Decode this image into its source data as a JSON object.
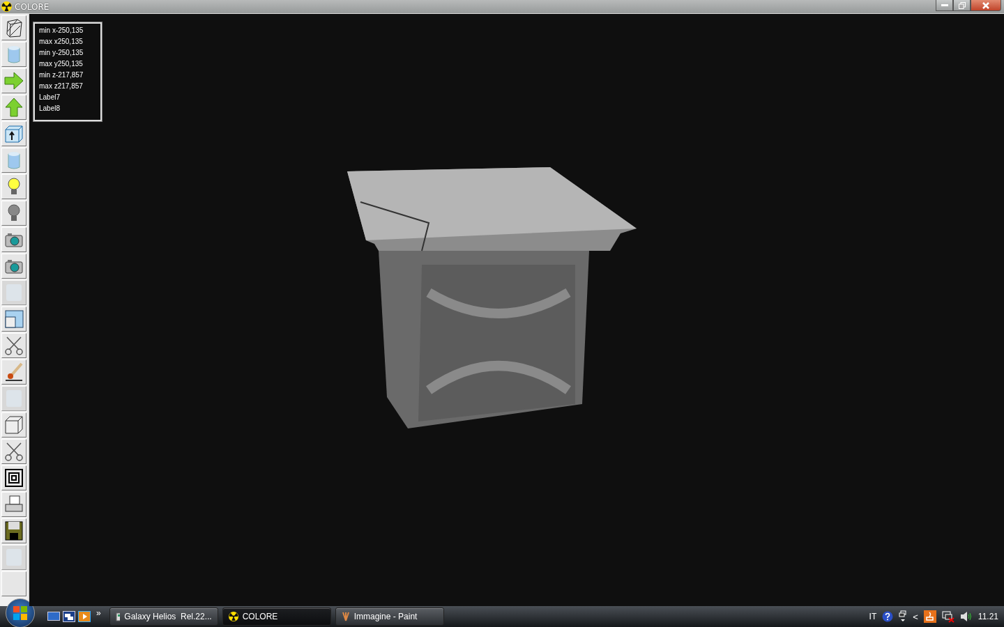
{
  "window": {
    "title": "COLORE"
  },
  "toolbar": [
    {
      "kind": "wireframe",
      "disabled": false
    },
    {
      "kind": "cylinder",
      "disabled": false
    },
    {
      "kind": "arrow-right",
      "disabled": false
    },
    {
      "kind": "arrow-up",
      "disabled": false
    },
    {
      "kind": "box-arrow",
      "disabled": false
    },
    {
      "kind": "cylinder",
      "disabled": false
    },
    {
      "kind": "bulb-on",
      "disabled": false
    },
    {
      "kind": "bulb-off",
      "disabled": false
    },
    {
      "kind": "camera",
      "disabled": false
    },
    {
      "kind": "camera",
      "disabled": false
    },
    {
      "kind": "texture",
      "disabled": true
    },
    {
      "kind": "window",
      "disabled": false
    },
    {
      "kind": "scissors",
      "disabled": false
    },
    {
      "kind": "brush",
      "disabled": false
    },
    {
      "kind": "texture",
      "disabled": true
    },
    {
      "kind": "cube",
      "disabled": false
    },
    {
      "kind": "scissors",
      "disabled": false
    },
    {
      "kind": "squares",
      "disabled": false
    },
    {
      "kind": "printer",
      "disabled": false
    },
    {
      "kind": "floppy",
      "disabled": false
    },
    {
      "kind": "texture",
      "disabled": true
    },
    {
      "kind": "empty",
      "disabled": false
    }
  ],
  "info_labels": [
    "min x-250,135",
    "max x250,135",
    "min y-250,135",
    "max y250,135",
    "min z-217,857",
    "max z217,857",
    "Label7",
    "Label8"
  ],
  "taskbar": {
    "quick_launch_more": "»",
    "tasks": [
      {
        "label": "Galaxy Helios  Rel.22...",
        "kind": "doc",
        "selected": false
      },
      {
        "label": "COLORE",
        "kind": "radiation",
        "selected": true
      },
      {
        "label": "Immagine - Paint",
        "kind": "paint",
        "selected": false
      }
    ],
    "language": "IT",
    "tray_more": "<",
    "clock": "11.21"
  }
}
